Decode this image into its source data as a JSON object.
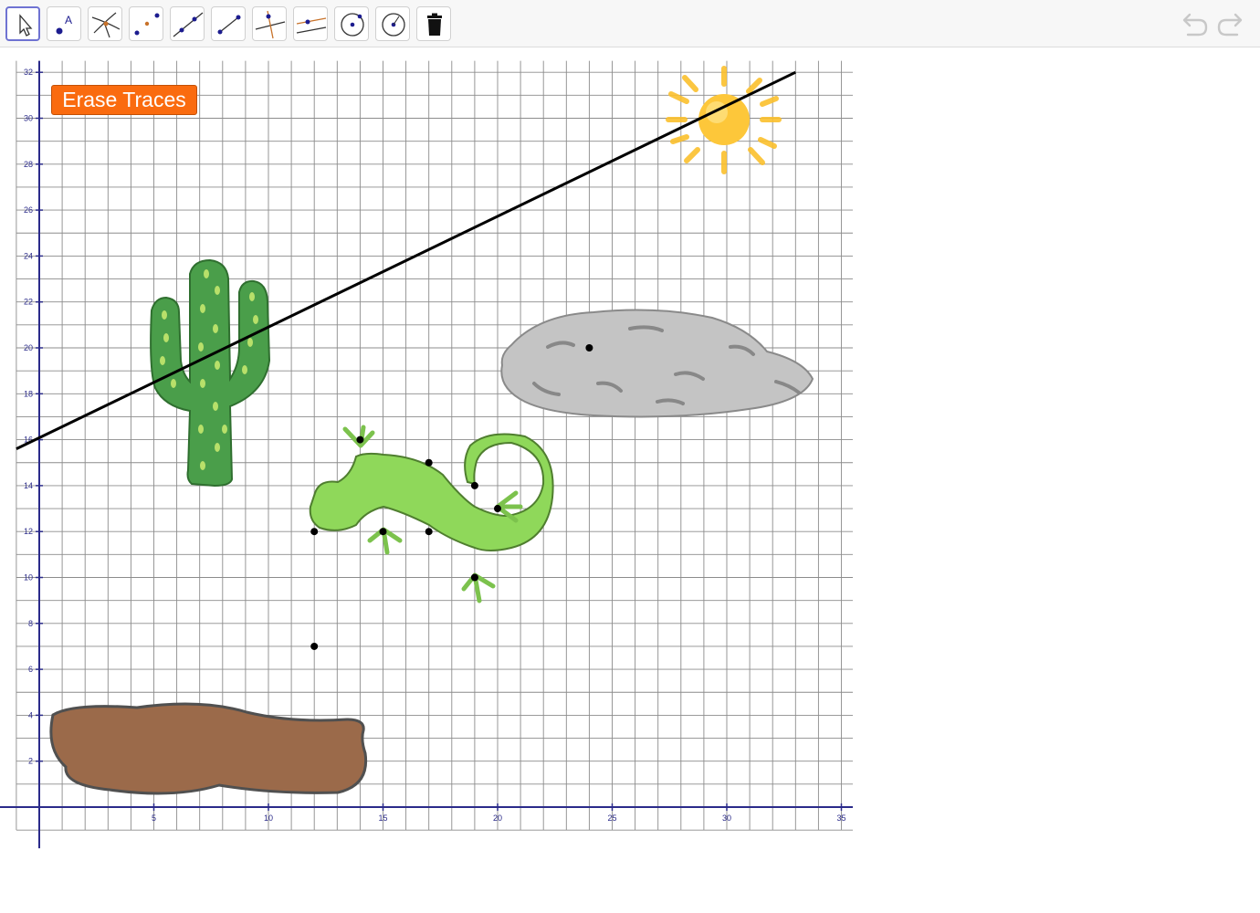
{
  "toolbar": {
    "tools": [
      {
        "name": "move-tool",
        "icon": "arrow-cursor-icon",
        "active": true
      },
      {
        "name": "point-tool",
        "icon": "point-icon",
        "active": false
      },
      {
        "name": "intersect-tool",
        "icon": "intersect-icon",
        "active": false
      },
      {
        "name": "midpoint-tool",
        "icon": "midpoint-icon",
        "active": false
      },
      {
        "name": "line-tool",
        "icon": "line-icon",
        "active": false
      },
      {
        "name": "segment-tool",
        "icon": "segment-icon",
        "active": false
      },
      {
        "name": "perpendicular-line-tool",
        "icon": "perpendicular-line-icon",
        "active": false
      },
      {
        "name": "parallel-line-tool",
        "icon": "parallel-line-icon",
        "active": false
      },
      {
        "name": "circle-center-point-tool",
        "icon": "circle-center-point-icon",
        "active": false
      },
      {
        "name": "circle-center-radius-tool",
        "icon": "circle-center-radius-icon",
        "active": false
      },
      {
        "name": "delete-tool",
        "icon": "trash-icon",
        "active": false
      }
    ],
    "undo_icon": "undo-icon",
    "redo_icon": "redo-icon"
  },
  "erase_button": {
    "label": "Erase Traces",
    "color": "#fa6b0f"
  },
  "graph": {
    "x_range": [
      -1,
      35.5
    ],
    "y_range": [
      -1,
      32.5
    ],
    "minor_step": 1,
    "x_tick_labels": [
      "5",
      "10",
      "15",
      "20",
      "25",
      "30",
      "35"
    ],
    "y_tick_labels": [
      "2",
      "4",
      "6",
      "8",
      "10",
      "12",
      "14",
      "16",
      "18",
      "20",
      "22",
      "24",
      "26",
      "28",
      "30",
      "32"
    ],
    "axis_color": "#2b2b8a",
    "grid_color": "#8c8c8c",
    "line": {
      "point_a": [
        -1,
        15.6
      ],
      "point_b": [
        33,
        32
      ],
      "color": "#000000"
    },
    "points": [
      [
        14,
        16
      ],
      [
        17,
        15
      ],
      [
        19,
        14
      ],
      [
        12,
        12
      ],
      [
        15,
        12
      ],
      [
        17,
        12
      ],
      [
        20,
        13
      ],
      [
        19,
        10
      ],
      [
        12,
        7
      ],
      [
        24,
        20
      ]
    ],
    "images": {
      "sun": "sun-icon",
      "cactus": "cactus-icon",
      "rock": "rock-icon",
      "lizard": "lizard-icon",
      "mud_puddle": "mud-puddle-icon"
    },
    "colors": {
      "cactus": "#4a9e4a",
      "lizard": "#8fd85a",
      "rock": "#b9b9b9",
      "puddle": "#9b6a4a",
      "sun": "#fbc02d"
    }
  }
}
